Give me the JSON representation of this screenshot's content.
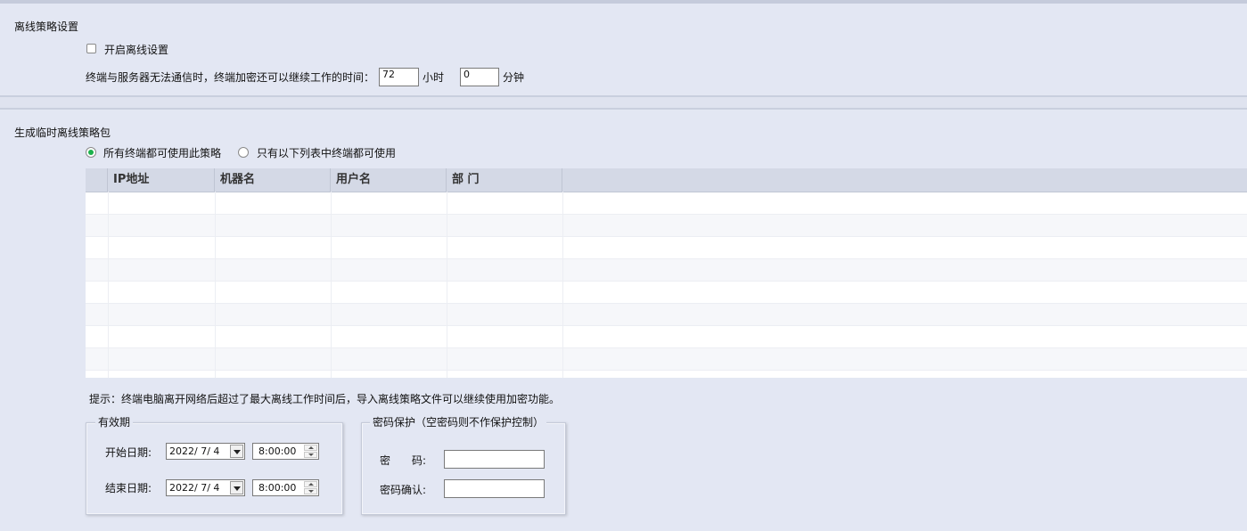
{
  "offline": {
    "section_title": "离线策略设置",
    "enable_label": "开启离线设置",
    "enable_checked": false,
    "time_desc": "终端与服务器无法通信时，终端加密还可以继续工作的时间：",
    "hours_value": "72",
    "hours_unit": "小时",
    "minutes_value": "0",
    "minutes_unit": "分钟"
  },
  "temp": {
    "section_title": "生成临时离线策略包",
    "radio_all": "所有终端都可使用此策略",
    "radio_list": "只有以下列表中终端都可使用",
    "selected": "all",
    "columns": [
      "IP地址",
      "机器名",
      "用户名",
      "部 门"
    ],
    "hint": "提示：终端电脑离开网络后超过了最大离线工作时间后，导入离线策略文件可以继续使用加密功能。"
  },
  "validity": {
    "legend": "有效期",
    "start_label": "开始日期:",
    "start_date": "2022/ 7/ 4",
    "start_time": "8:00:00",
    "end_label": "结束日期:",
    "end_date": "2022/ 7/ 4",
    "end_time": "8:00:00"
  },
  "password": {
    "legend": "密码保护（空密码则不作保护控制）",
    "pwd_label": "密　　码:",
    "confirm_label": "密码确认:"
  },
  "colors": {
    "background": "#e3e7f3",
    "header": "#d4d9e6",
    "radio_selected": "#1bb14c"
  }
}
